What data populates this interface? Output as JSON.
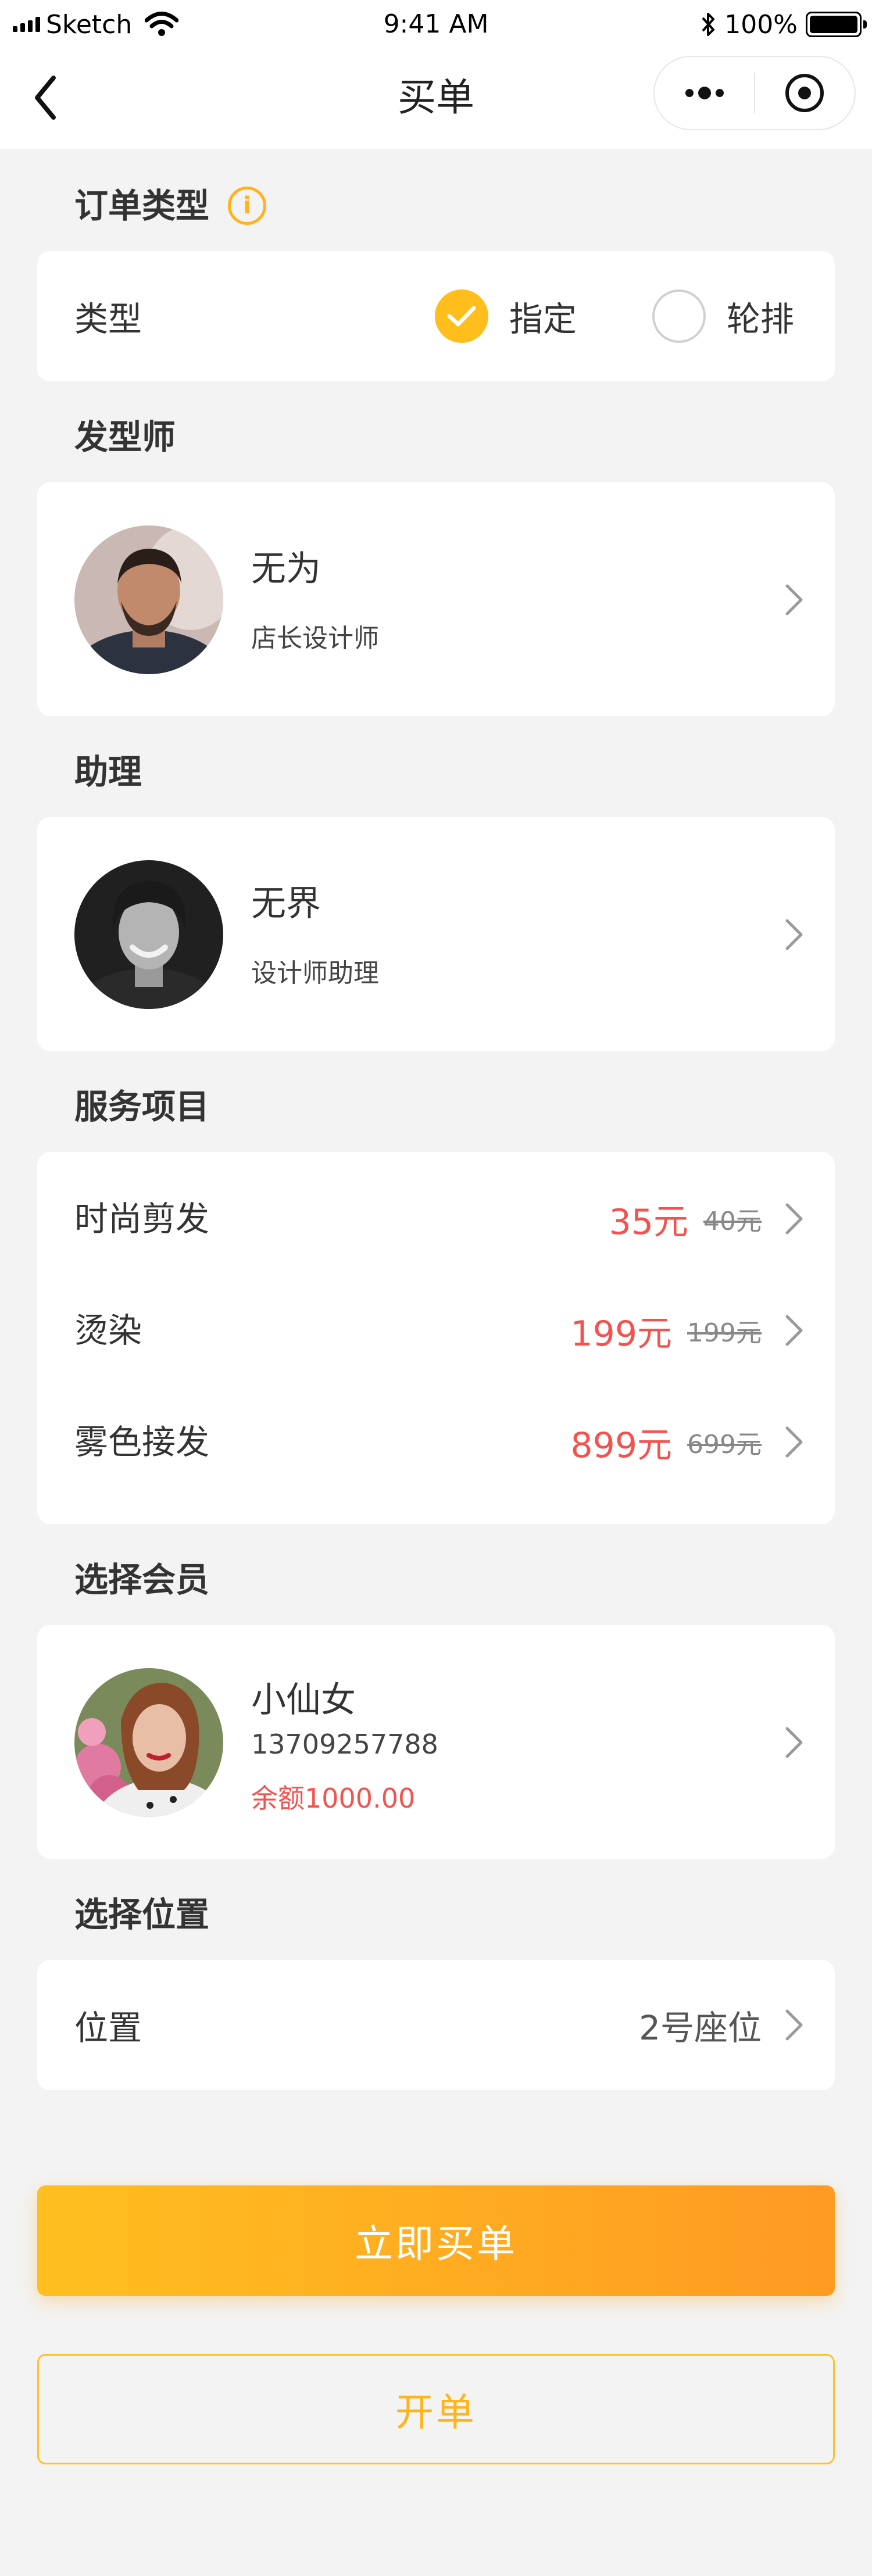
{
  "status_bar": {
    "carrier": "Sketch",
    "time": "9:41 AM",
    "battery": "100%"
  },
  "nav": {
    "title": "买单",
    "back_icon": "chevron-left-icon",
    "more_icon": "more-dots-icon",
    "close_icon": "target-close-icon"
  },
  "order_type": {
    "title": "订单类型",
    "info_icon": "i",
    "label": "类型",
    "options": [
      "指定",
      "轮排"
    ],
    "selected": "指定"
  },
  "stylist": {
    "title": "发型师",
    "name": "无为",
    "role": "店长设计师"
  },
  "assistant": {
    "title": "助理",
    "name": "无界",
    "role": "设计师助理"
  },
  "services": {
    "title": "服务项目",
    "items": [
      {
        "name": "时尚剪发",
        "price": "35元",
        "original": "40元"
      },
      {
        "name": "烫染",
        "price": "199元",
        "original": "199元"
      },
      {
        "name": "雾色接发",
        "price": "899元",
        "original": "699元"
      }
    ]
  },
  "member": {
    "title": "选择会员",
    "name": "小仙女",
    "phone": "13709257788",
    "balance": "余额1000.00"
  },
  "position": {
    "title": "选择位置",
    "label": "位置",
    "value": "2号座位"
  },
  "actions": {
    "buy_now": "立即买单",
    "open_order": "开单"
  },
  "colors": {
    "accent": "#ffbe1c",
    "price": "#f4524e",
    "background": "#f3f3f3"
  }
}
